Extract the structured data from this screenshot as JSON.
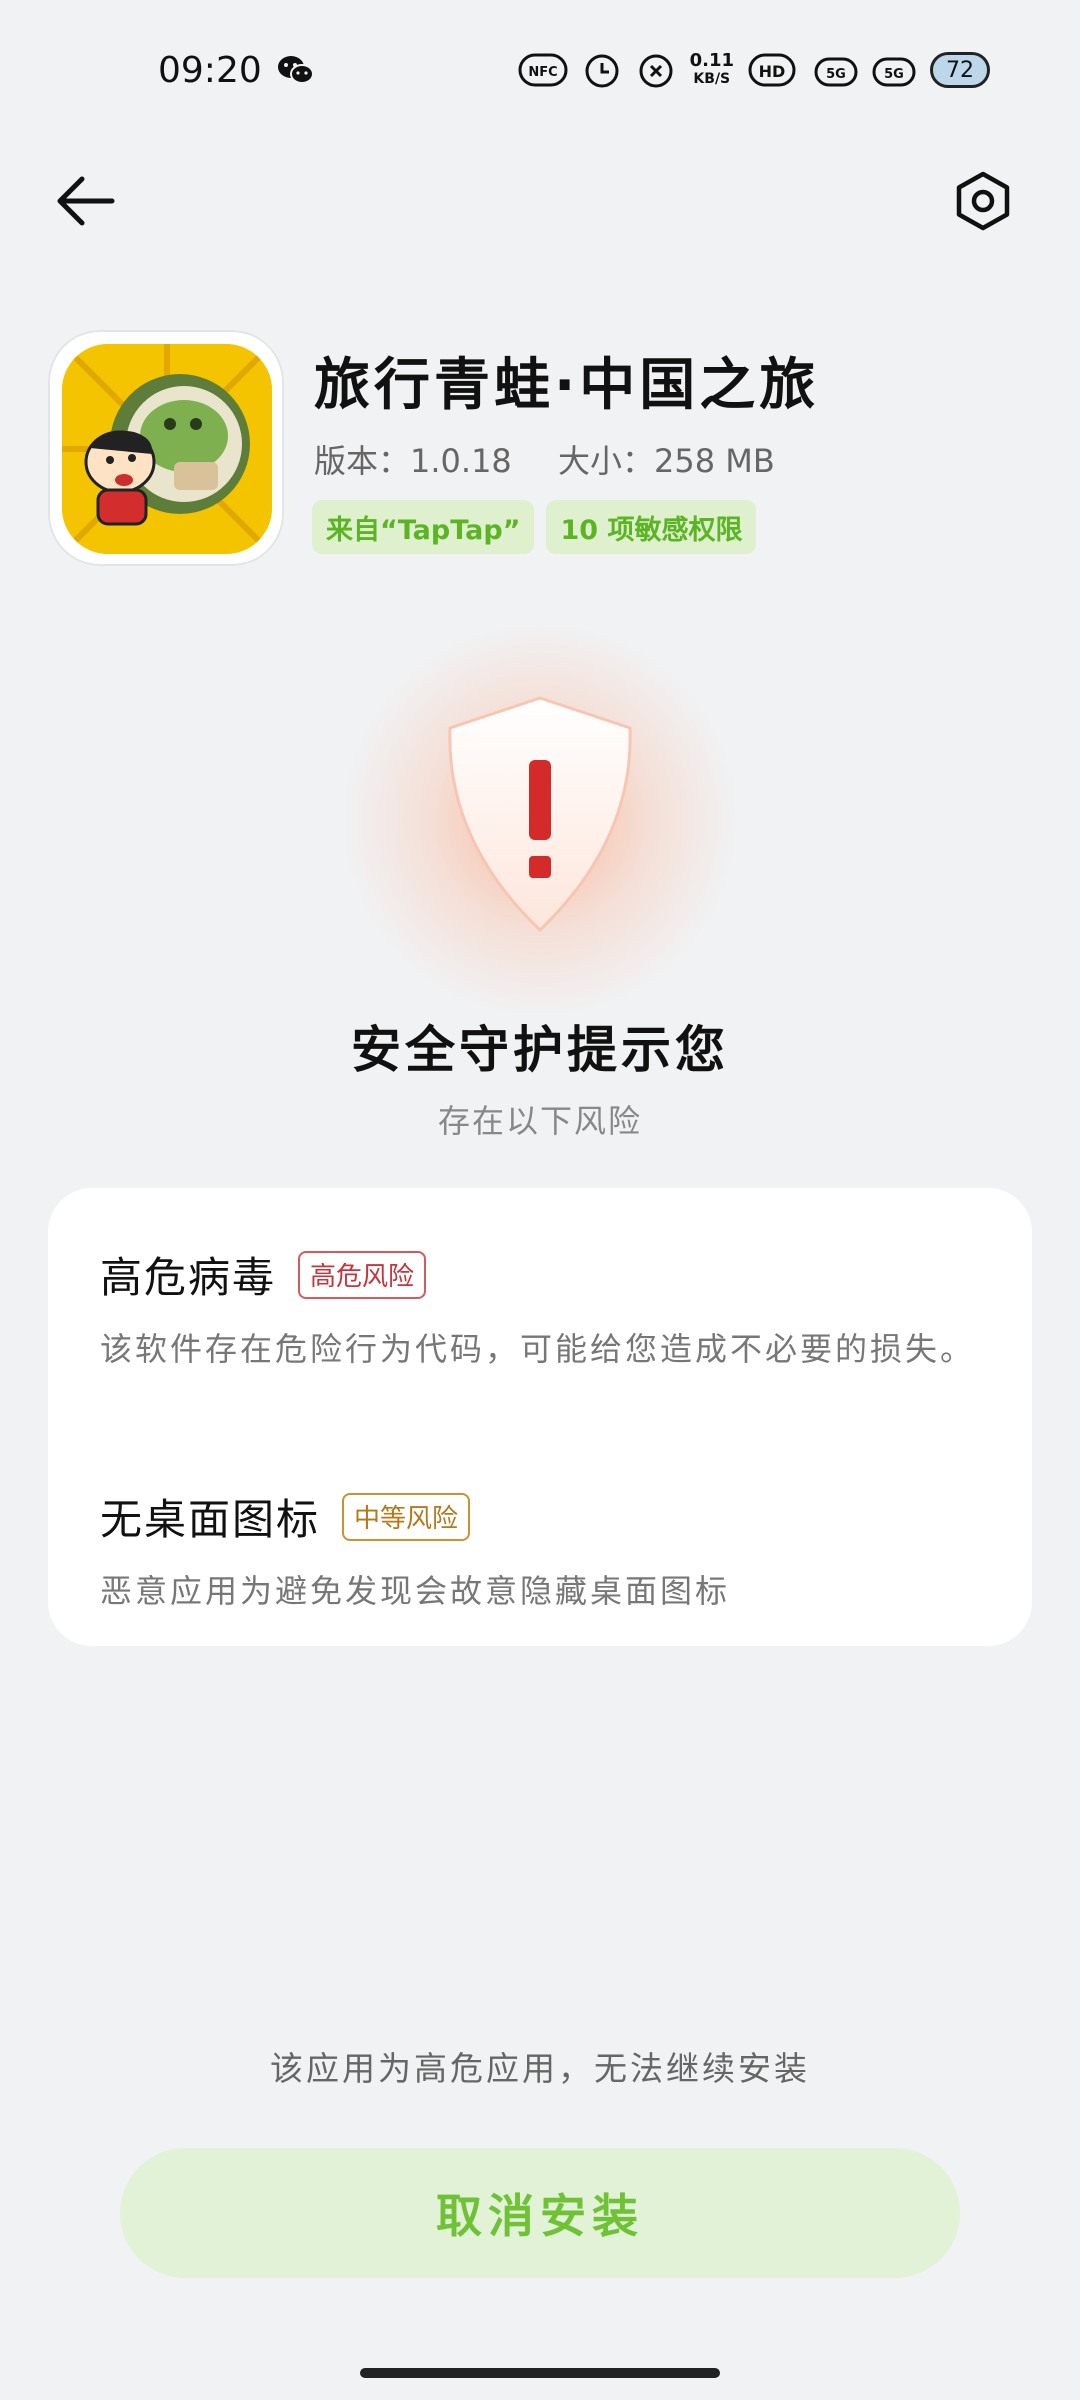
{
  "status_bar": {
    "time": "09:20",
    "net_speed_value": "0.11",
    "net_speed_unit": "KB/S",
    "hd_label": "HD",
    "signal_1": "5G",
    "signal_2": "5G",
    "nfc_label": "NFC",
    "battery": "72"
  },
  "app": {
    "name": "旅行青蛙·中国之旅",
    "version_text": "版本：1.0.18",
    "size_text": "大小：258 MB",
    "tags": [
      "来自“TapTap”",
      "10 项敏感权限"
    ]
  },
  "warning": {
    "title": "安全守护提示您",
    "subtitle": "存在以下风险"
  },
  "risks": [
    {
      "name": "高危病毒",
      "badge": "高危风险",
      "description": "该软件存在危险行为代码，可能给您造成不必要的损失。"
    },
    {
      "name": "无桌面图标",
      "badge": "中等风险",
      "description": "恶意应用为避免发现会故意隐藏桌面图标"
    }
  ],
  "notice": "该应用为高危应用，无法继续安装",
  "cancel_button": "取消安装",
  "colors": {
    "accent_green": "#6fc236",
    "tag_bg": "#dff0cf",
    "high_risk": "#c8343a",
    "medium_risk": "#b5791b",
    "shield_mark": "#d42a2a"
  },
  "icons": {
    "back": "back-arrow-icon",
    "settings": "settings-hexagon-icon",
    "shield": "shield-warning-icon"
  }
}
